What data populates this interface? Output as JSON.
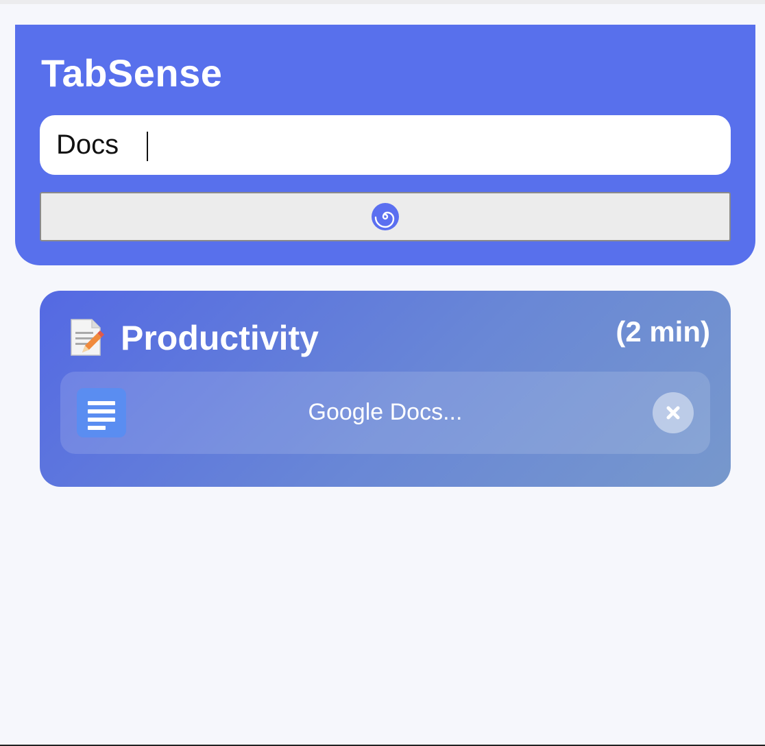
{
  "app": {
    "title": "TabSense"
  },
  "search": {
    "value": "Docs",
    "placeholder": ""
  },
  "action_button": {
    "icon": "spiral-icon",
    "label": ""
  },
  "groups": [
    {
      "icon": "memo-icon",
      "title": "Productivity",
      "time": "(2 min)",
      "tabs": [
        {
          "icon": "google-docs-icon",
          "title": "Google Docs...",
          "close_icon": "close-icon"
        }
      ]
    }
  ],
  "colors": {
    "header_bg": "#5870ec",
    "page_bg": "#f6f7fc",
    "group_gradient_start": "#5469e3",
    "group_gradient_end": "#7798cc",
    "favicon_bg": "#5a8df1"
  }
}
